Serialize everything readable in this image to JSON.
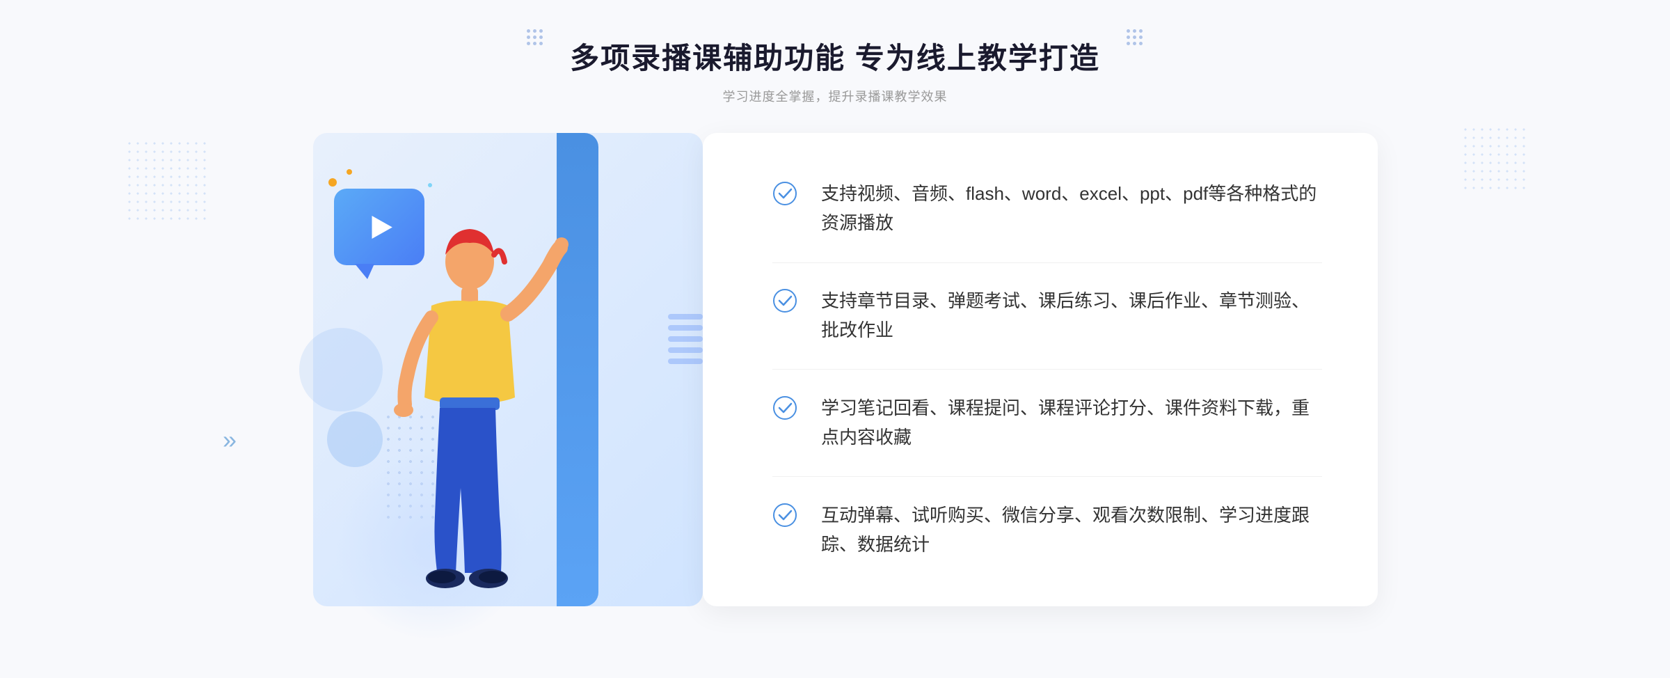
{
  "header": {
    "title": "多项录播课辅助功能 专为线上教学打造",
    "subtitle": "学习进度全掌握，提升录播课教学效果"
  },
  "features": [
    {
      "id": "feature-1",
      "text": "支持视频、音频、flash、word、excel、ppt、pdf等各种格式的资源播放"
    },
    {
      "id": "feature-2",
      "text": "支持章节目录、弹题考试、课后练习、课后作业、章节测验、批改作业"
    },
    {
      "id": "feature-3",
      "text": "学习笔记回看、课程提问、课程评论打分、课件资料下载，重点内容收藏"
    },
    {
      "id": "feature-4",
      "text": "互动弹幕、试听购买、微信分享、观看次数限制、学习进度跟踪、数据统计"
    }
  ],
  "decorators": {
    "left_chevron": "»",
    "check_color": "#4a90e2"
  }
}
